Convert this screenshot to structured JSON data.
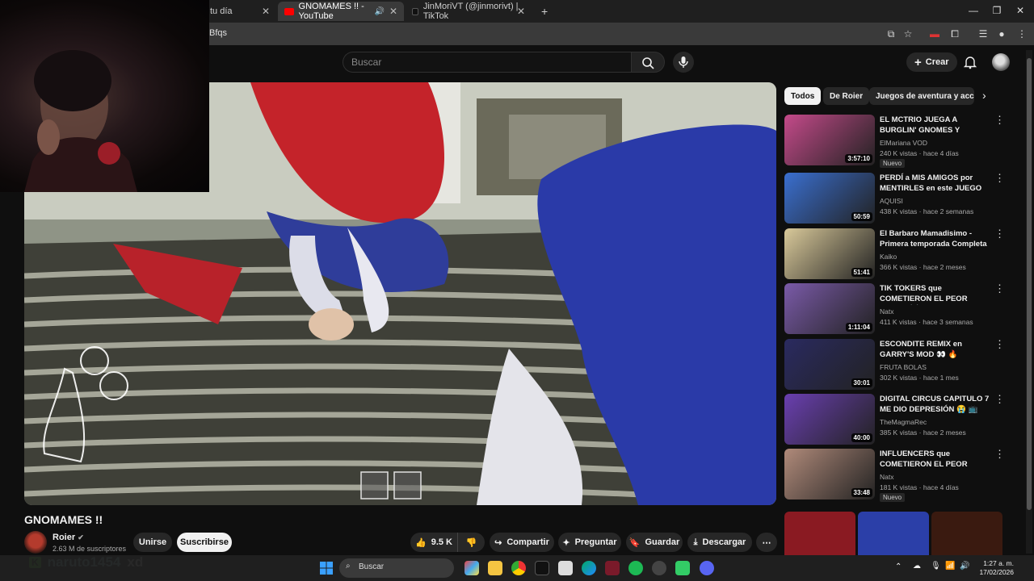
{
  "browser": {
    "tabs": [
      {
        "label": "tu día"
      },
      {
        "label": "GNOMAMES !! - YouTube"
      },
      {
        "label": "JinMoriVT (@jinmorivt) | TikTok"
      }
    ],
    "url_fragment": "Bfqs"
  },
  "header": {
    "search_placeholder": "Buscar",
    "create_label": "Crear"
  },
  "video": {
    "title": "GNOMAMES !!",
    "channel": "Roier",
    "subscribers": "2.63 M de suscriptores",
    "join_label": "Unirse",
    "subscribe_label": "Suscribirse",
    "likes": "9.5 K",
    "share_label": "Compartir",
    "ask_label": "Preguntar",
    "save_label": "Guardar",
    "download_label": "Descargar"
  },
  "chat": {
    "user": "naruto1454",
    "message": "xd"
  },
  "sidebar": {
    "chips": [
      "Todos",
      "De Roier",
      "Juegos de aventura y acción"
    ],
    "recommendations": [
      {
        "title": "EL MCTRIO JUEGA A BURGLIN' GNOMES Y CURSED ...",
        "channel": "ElMariana VOD",
        "meta": "240 K vistas · hace 4 días",
        "badge": "Nuevo",
        "duration": "3:57:10",
        "color": "#c44a8a"
      },
      {
        "title": "PERDÍ a MIS AMIGOS por MENTIRLES en este JUEGO",
        "channel": "AQUISI",
        "meta": "438 K vistas · hace 2 semanas",
        "badge": "",
        "duration": "50:59",
        "color": "#3a6fd0"
      },
      {
        "title": "El Barbaro Mamadisimo - Primera temporada Completa ...",
        "channel": "Kaiko",
        "meta": "366 K vistas · hace 2 meses",
        "badge": "",
        "duration": "51:41",
        "color": "#d9c99a"
      },
      {
        "title": "TIK TOKERS que COMETIERON EL PEOR ERROR ☠️",
        "channel": "Natx",
        "meta": "411 K vistas · hace 3 semanas",
        "badge": "",
        "duration": "1:11:04",
        "color": "#7a5aa8"
      },
      {
        "title": "ESCONDITE REMIX en GARRY'S MOD 👀 🔥",
        "channel": "FRUTA BOLAS",
        "meta": "302 K vistas · hace 1 mes",
        "badge": "",
        "duration": "30:01",
        "color": "#2a2a60"
      },
      {
        "title": "DIGITAL CIRCUS CAPITULO 7 ME DIO DEPRESIÓN 😭 📺",
        "channel": "TheMagmaRec",
        "meta": "385 K vistas · hace 2 meses",
        "badge": "",
        "duration": "40:00",
        "color": "#6a3fb0"
      },
      {
        "title": "INFLUENCERS que COMETIERON EL PEOR ERRO...",
        "channel": "Natx",
        "meta": "181 K vistas · hace 4 días",
        "badge": "Nuevo",
        "duration": "33:48",
        "color": "#b08a7a"
      }
    ]
  },
  "taskbar": {
    "search_label": "Buscar",
    "time": "1:27 a. m.",
    "date": "17/02/2026"
  }
}
